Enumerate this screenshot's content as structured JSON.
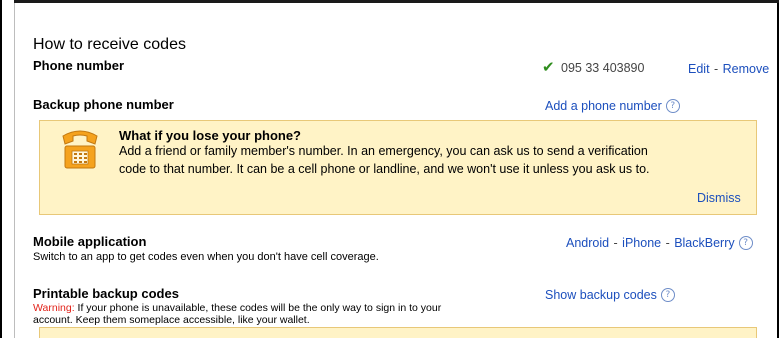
{
  "section_title": "How to receive codes",
  "phone": {
    "heading": "Phone number",
    "number": "095 33 403890",
    "edit_label": "Edit",
    "separator": "-",
    "remove_label": "Remove"
  },
  "backup_phone": {
    "heading": "Backup phone number",
    "add_link": "Add a phone number",
    "help_glyph": "?"
  },
  "notice": {
    "title": "What if you lose your phone?",
    "line1": "Add a friend or family member's number. In an emergency, you can ask us to send a verification",
    "line2": "code to that number. It can be a cell phone or landline, and we won't use it unless you ask us to.",
    "dismiss_label": "Dismiss"
  },
  "mobile_app": {
    "heading": "Mobile application",
    "description": "Switch to an app to get codes even when you don't have cell coverage.",
    "android_label": "Android",
    "iphone_label": "iPhone",
    "blackberry_label": "BlackBerry",
    "separator": "-",
    "help_glyph": "?"
  },
  "backup_codes": {
    "heading": "Printable backup codes",
    "warning_label": "Warning:",
    "warning_text_line1": " If your phone is unavailable, these codes will be the only way to sign in to your",
    "warning_text_line2": "account. Keep them someplace accessible, like your wallet.",
    "show_link": "Show backup codes",
    "help_glyph": "?"
  },
  "icons": {
    "check": "checkmark-icon",
    "phone": "telephone-icon",
    "help": "help-icon"
  },
  "colors": {
    "link": "#1c4fbd",
    "notice_bg": "#fff3c6",
    "notice_border": "#e8c878",
    "check": "#2f8d1e",
    "warning": "#e2231a"
  }
}
